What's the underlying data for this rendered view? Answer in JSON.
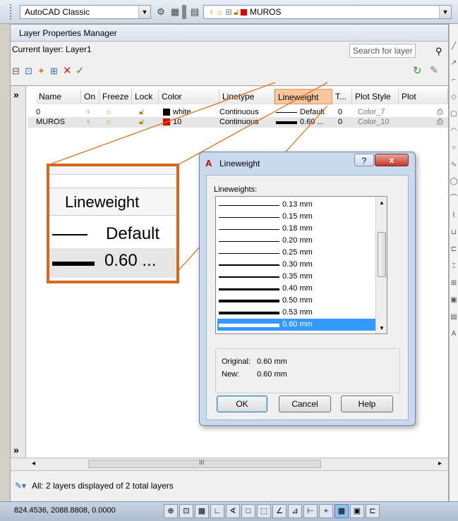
{
  "toolbar": {
    "workspace": "AutoCAD Classic",
    "current_layer_combo": "MUROS",
    "layer_swatch_color": "#e00000"
  },
  "palette": {
    "title": "Layer Properties Manager",
    "current_layer": "Current layer: Layer1",
    "search_placeholder": "Search for layer",
    "expand_glyph": "»",
    "columns": [
      "Name",
      "On",
      "Freeze",
      "Lock",
      "Color",
      "Linetype",
      "Lineweight",
      "T...",
      "Plot Style",
      "Plot"
    ],
    "rows": [
      {
        "name": "0",
        "color_name": "white",
        "color_hex": "#000000",
        "linetype": "Continuous",
        "lineweight": "Default",
        "transparency": "0",
        "plot_style": "Color_7"
      },
      {
        "name": "MUROS",
        "color_name": "10",
        "color_hex": "#e00000",
        "linetype": "Continuous",
        "lineweight": "0.60 ...",
        "transparency": "0",
        "plot_style": "Color_10"
      }
    ],
    "scroll_marker": "III",
    "status_text": "All: 2 layers displayed of 2 total layers"
  },
  "coords": "824.4536,  2088.8808, 0.0000",
  "dialog": {
    "title": "Lineweight",
    "help_glyph": "?",
    "close_glyph": "x",
    "list_label": "Lineweights:",
    "items": [
      "0.13 mm",
      "0.15 mm",
      "0.18 mm",
      "0.20 mm",
      "0.25 mm",
      "0.30 mm",
      "0.35 mm",
      "0.40 mm",
      "0.50 mm",
      "0.53 mm",
      "0.60 mm"
    ],
    "selected": "0.60 mm",
    "original_label": "Original:",
    "original_value": "0.60 mm",
    "new_label": "New:",
    "new_value": "0.60 mm",
    "ok": "OK",
    "cancel": "Cancel",
    "help": "Help"
  },
  "zoom": {
    "header": "Lineweight",
    "row1": "Default",
    "row2": "0.60 ..."
  },
  "colors": {
    "highlight": "#f9c79e",
    "callout": "#d2691e",
    "selection": "#3399ff"
  }
}
